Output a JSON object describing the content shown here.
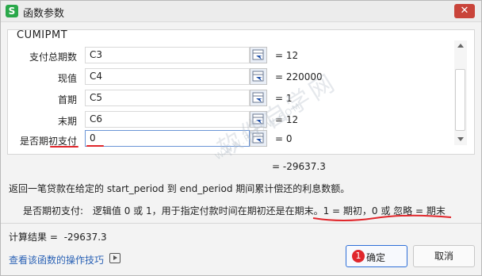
{
  "window": {
    "title": "函数参数",
    "app_icon_letter": "S",
    "close_label": "✕"
  },
  "function": {
    "name": "CUMIPMT"
  },
  "params": [
    {
      "label": "支付总期数",
      "value": "C3",
      "result": "= 12"
    },
    {
      "label": "现值",
      "value": "C4",
      "result": "= 220000"
    },
    {
      "label": "首期",
      "value": "C5",
      "result": "= 1"
    },
    {
      "label": "末期",
      "value": "C6",
      "result": "= 12"
    },
    {
      "label": "是否期初支付",
      "value": "0",
      "result": "= 0"
    }
  ],
  "formula_result": "= -29637.3",
  "description": "返回一笔贷款在给定的 start_period 到 end_period 期间累计偿还的利息数额。",
  "param_description": {
    "label": "是否期初支付:",
    "text": "逻辑值 0 或 1，用于指定付款时间在期初还是在期末。1 = 期初，0 或 忽略 = 期末"
  },
  "calc_result": {
    "label": "计算结果 =",
    "value": "-29637.3"
  },
  "help_link": "查看该函数的操作技巧",
  "buttons": {
    "ok": "确定",
    "cancel": "取消",
    "ok_badge": "1"
  },
  "watermark": {
    "main": "软件自学网",
    "sub": "WWW.RJZXW.COM"
  },
  "colors": {
    "accent": "#2e6fd8",
    "annotation_red": "#e0262b",
    "link": "#2b62b5"
  }
}
